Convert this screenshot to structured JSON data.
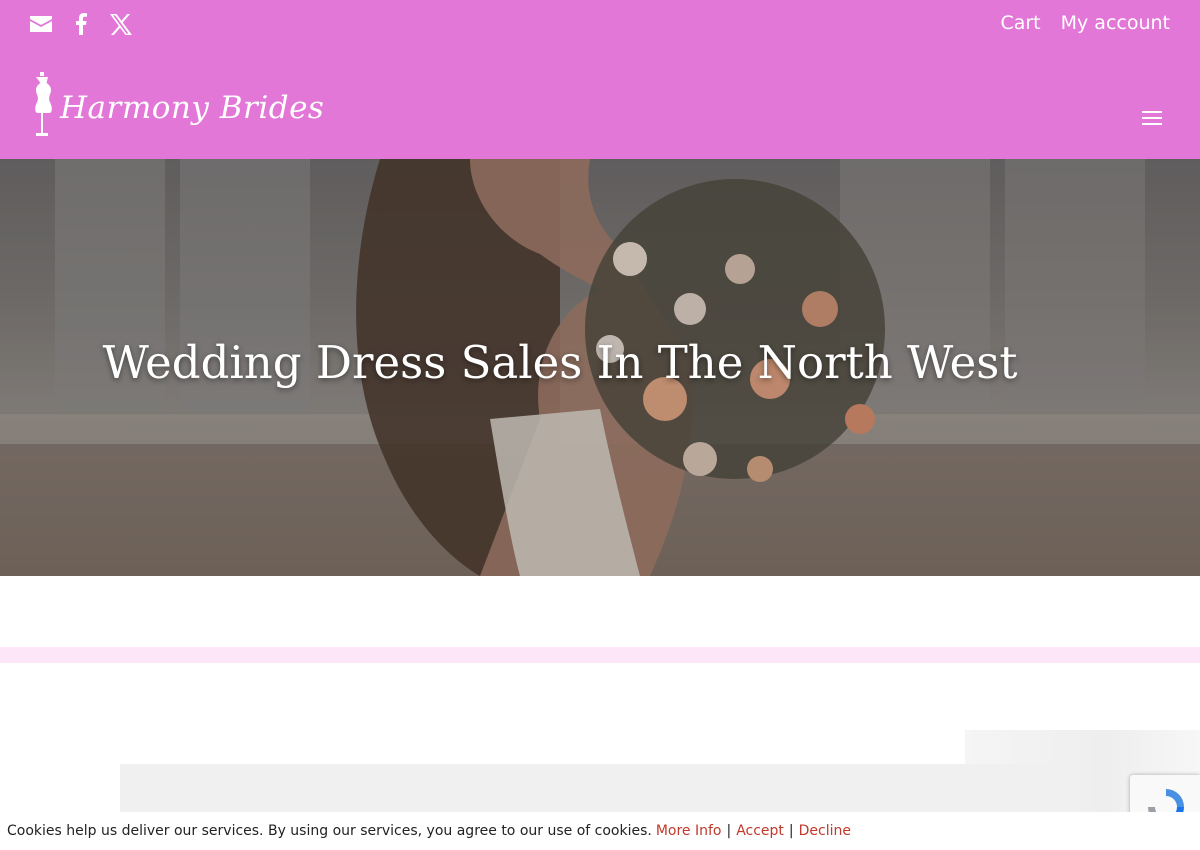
{
  "header": {
    "social": [
      "email-icon",
      "facebook-icon",
      "x-icon"
    ],
    "links": {
      "cart": "Cart",
      "account": "My account"
    },
    "logo_text": "Harmony Brides",
    "menu_icon": "hamburger-icon"
  },
  "hero": {
    "title": "Wedding Dress Sales In The North West"
  },
  "cookie_bar": {
    "message": "Cookies help us deliver our services. By using our services, you agree to our use of cookies.",
    "more_info": "More Info",
    "accept": "Accept",
    "decline": "Decline",
    "separator": "|"
  },
  "colors": {
    "header_bg": "#e277d8",
    "divider": "#fce6f7",
    "link_red": "#c0392b"
  }
}
